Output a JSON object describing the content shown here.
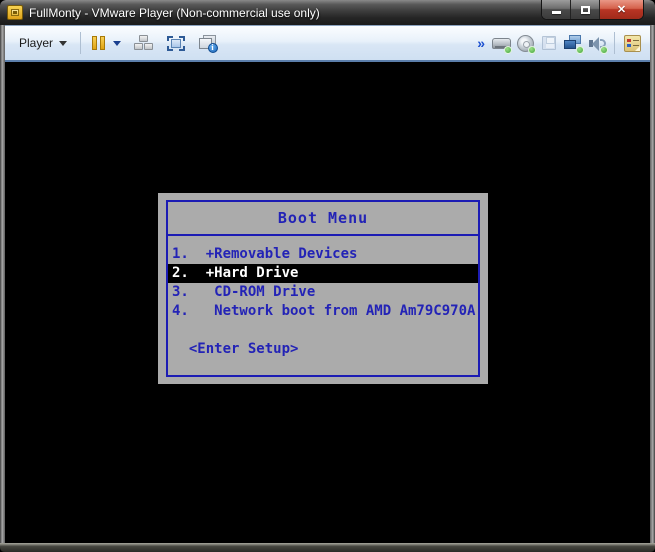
{
  "window": {
    "title": "FullMonty - VMware Player (Non-commercial use only)",
    "controls": {
      "close_glyph": "✕"
    }
  },
  "toolbar": {
    "player_menu_label": "Player",
    "more_chevron_glyph": "»",
    "info_badge_glyph": "i",
    "icons": {
      "pause": "suspend-vm",
      "ctrl_alt_del": "send-ctrl-alt-del",
      "fullscreen": "enter-fullscreen",
      "windows_info": "manage-vm-info",
      "hard_disk": "hard-disk-status",
      "cd_rom": "cd-dvd-status",
      "floppy": "floppy-status",
      "network": "network-adapter-status",
      "sound": "sound-status",
      "library": "library-panel"
    }
  },
  "boot_menu": {
    "title": "Boot Menu",
    "items": [
      {
        "text": "1.  +Removable Devices",
        "selected": false
      },
      {
        "text": "2.  +Hard Drive",
        "selected": true
      },
      {
        "text": "3.   CD-ROM Drive",
        "selected": false
      },
      {
        "text": "4.   Network boot from AMD Am79C970A",
        "selected": false
      }
    ],
    "footer": "  <Enter Setup>",
    "colors": {
      "background": "#ababab",
      "text": "#2323b6",
      "border": "#1c1cb4",
      "selected_bg": "#000000",
      "selected_text": "#ffffff"
    }
  },
  "status": {
    "led_color": "#3fa53a",
    "screen_bg": "#000000"
  }
}
